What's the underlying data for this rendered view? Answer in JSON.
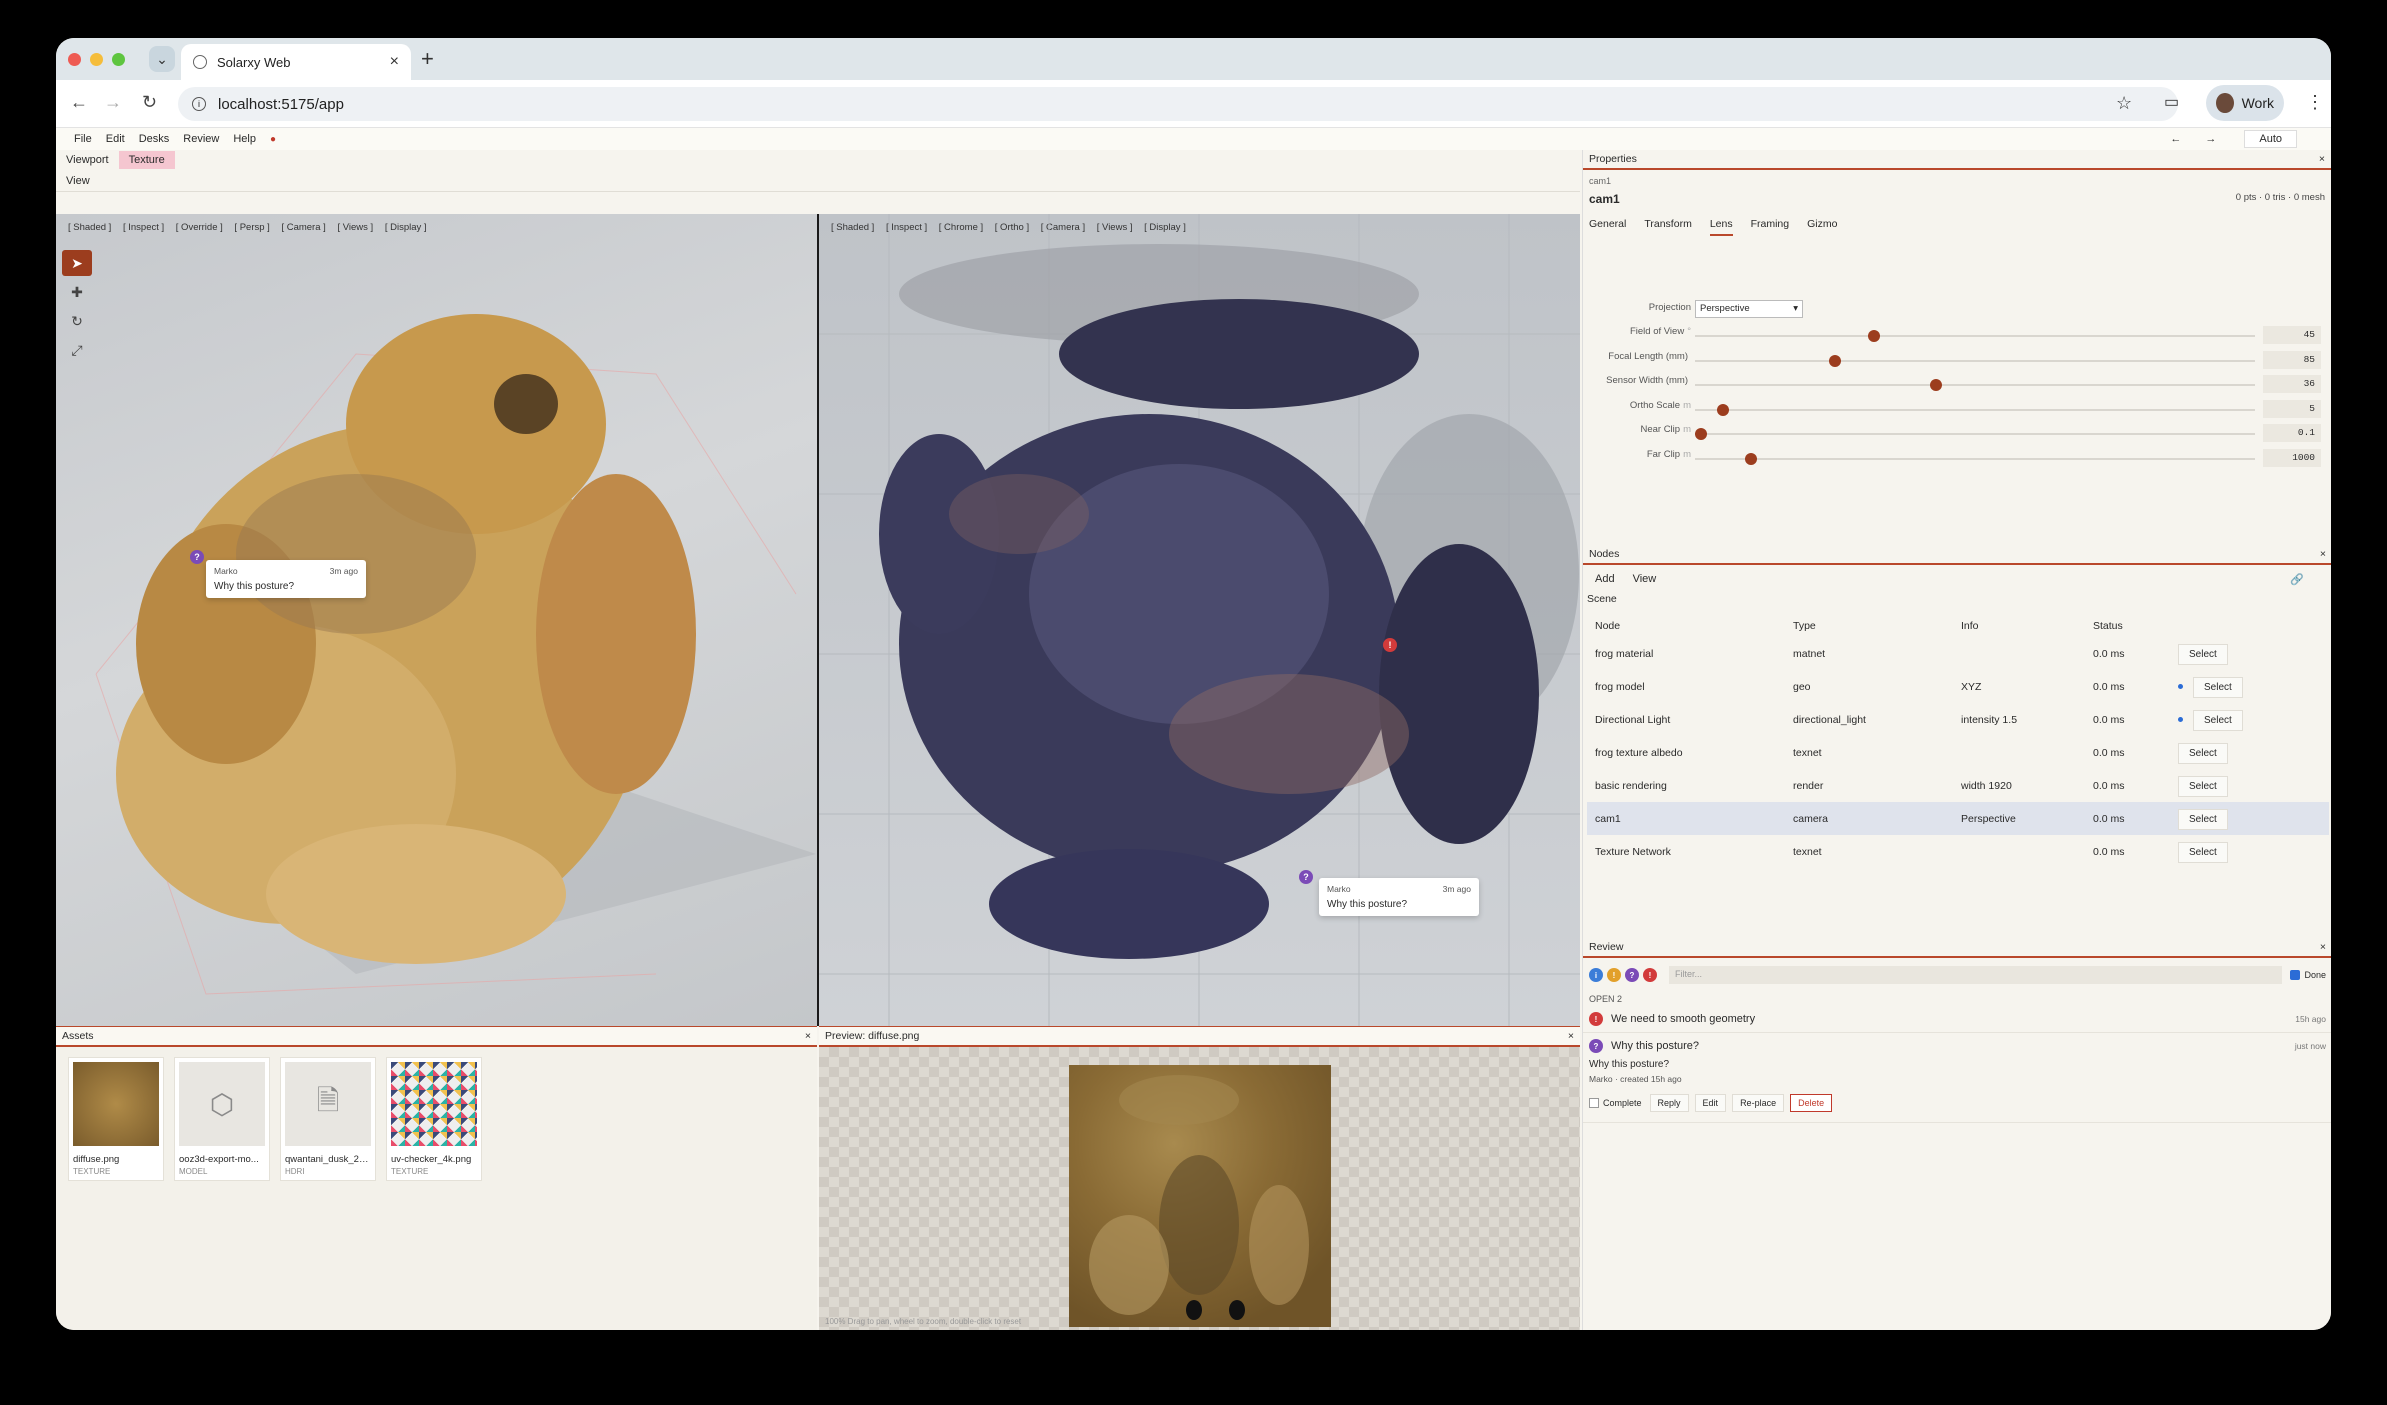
{
  "browser": {
    "tab_title": "Solarxy Web",
    "url": "localhost:5175/app",
    "profile": "Work"
  },
  "menu": {
    "items": [
      "File",
      "Edit",
      "Desks",
      "Review",
      "Help"
    ],
    "auto_label": "Auto"
  },
  "left": {
    "tabs": [
      "Viewport",
      "Texture"
    ],
    "view_label": "View",
    "vp1_toolbar": [
      "[ Shaded ]",
      "[ Inspect ]",
      "[ Override ]",
      "[ Persp ]",
      "[ Camera ]",
      "[ Views ]",
      "[ Display ]"
    ],
    "vp2_toolbar": [
      "[ Shaded ]",
      "[ Inspect ]",
      "[ Chrome ]",
      "[ Ortho ]",
      "[ Camera ]",
      "[ Views ]",
      "[ Display ]"
    ],
    "comment1": {
      "author": "Marko",
      "time": "3m ago",
      "text": "Why this posture?"
    },
    "comment2": {
      "author": "Marko",
      "time": "3m ago",
      "text": "Why this posture?"
    }
  },
  "assets": {
    "title": "Assets",
    "items": [
      {
        "name": "diffuse.png",
        "type": "TEXTURE",
        "icon": "texture-thumb"
      },
      {
        "name": "ooz3d-export-mo...",
        "type": "MODEL",
        "icon": "cube-icon"
      },
      {
        "name": "qwantani_dusk_2_...",
        "type": "HDRI",
        "icon": "file-icon"
      },
      {
        "name": "uv-checker_4k.png",
        "type": "TEXTURE",
        "icon": "checker-thumb"
      }
    ]
  },
  "preview": {
    "title": "Preview: diffuse.png",
    "hint": "100% Drag to pan, wheel to zoom, double-click to reset"
  },
  "properties": {
    "title": "Properties",
    "crumb": "cam1",
    "name": "cam1",
    "meta": "0 pts · 0 tris · 0 mesh",
    "tabs": [
      "General",
      "Transform",
      "Lens",
      "Framing",
      "Gizmo"
    ],
    "projection_label": "Projection",
    "projection_value": "Perspective",
    "params": [
      {
        "label": "Field of View",
        "unit": "°",
        "value": "45",
        "frac": 0.32
      },
      {
        "label": "Focal Length (mm)",
        "unit": "",
        "value": "85",
        "frac": 0.25
      },
      {
        "label": "Sensor Width (mm)",
        "unit": "",
        "value": "36",
        "frac": 0.43
      },
      {
        "label": "Ortho Scale",
        "unit": "m",
        "value": "5",
        "frac": 0.05
      },
      {
        "label": "Near Clip",
        "unit": "m",
        "value": "0.1",
        "frac": 0.01
      },
      {
        "label": "Far Clip",
        "unit": "m",
        "value": "1000",
        "frac": 0.1
      }
    ]
  },
  "nodes": {
    "title": "Nodes",
    "add": "Add",
    "view": "View",
    "scene": "Scene",
    "headers": [
      "Node",
      "Type",
      "Info",
      "Status"
    ],
    "select_label": "Select",
    "rows": [
      {
        "node": "frog material",
        "type": "matnet",
        "info": "",
        "status": "0.0 ms",
        "dot": false
      },
      {
        "node": "frog model",
        "type": "geo",
        "info": "XYZ",
        "status": "0.0 ms",
        "dot": true
      },
      {
        "node": "Directional Light",
        "type": "directional_light",
        "info": "intensity 1.5",
        "status": "0.0 ms",
        "dot": true
      },
      {
        "node": "frog texture albedo",
        "type": "texnet",
        "info": "",
        "status": "0.0 ms",
        "dot": false
      },
      {
        "node": "basic rendering",
        "type": "render",
        "info": "width 1920",
        "status": "0.0 ms",
        "dot": false
      },
      {
        "node": "cam1",
        "type": "camera",
        "info": "Perspective",
        "status": "0.0 ms",
        "dot": false,
        "selected": true
      },
      {
        "node": "Texture Network",
        "type": "texnet",
        "info": "",
        "status": "0.0 ms",
        "dot": false
      }
    ]
  },
  "review": {
    "title": "Review",
    "filter_placeholder": "Filter...",
    "done_label": "Done",
    "open_label": "OPEN",
    "open_count": "2",
    "issue1": {
      "text": "We need to smooth geometry",
      "time": "15h ago"
    },
    "issue2": {
      "text": "Why this posture?",
      "time": "just now"
    },
    "issue2_body": "Why this posture?",
    "issue2_meta": "Marko · created 15h ago",
    "actions": {
      "complete": "Complete",
      "reply": "Reply",
      "edit": "Edit",
      "replace": "Re-place",
      "delete": "Delete"
    }
  },
  "colors": {
    "accent": "#9c3d1e",
    "blue": "#2b6cd6",
    "pin_purple": "#7b4bb7",
    "pin_red": "#d23b3b"
  }
}
